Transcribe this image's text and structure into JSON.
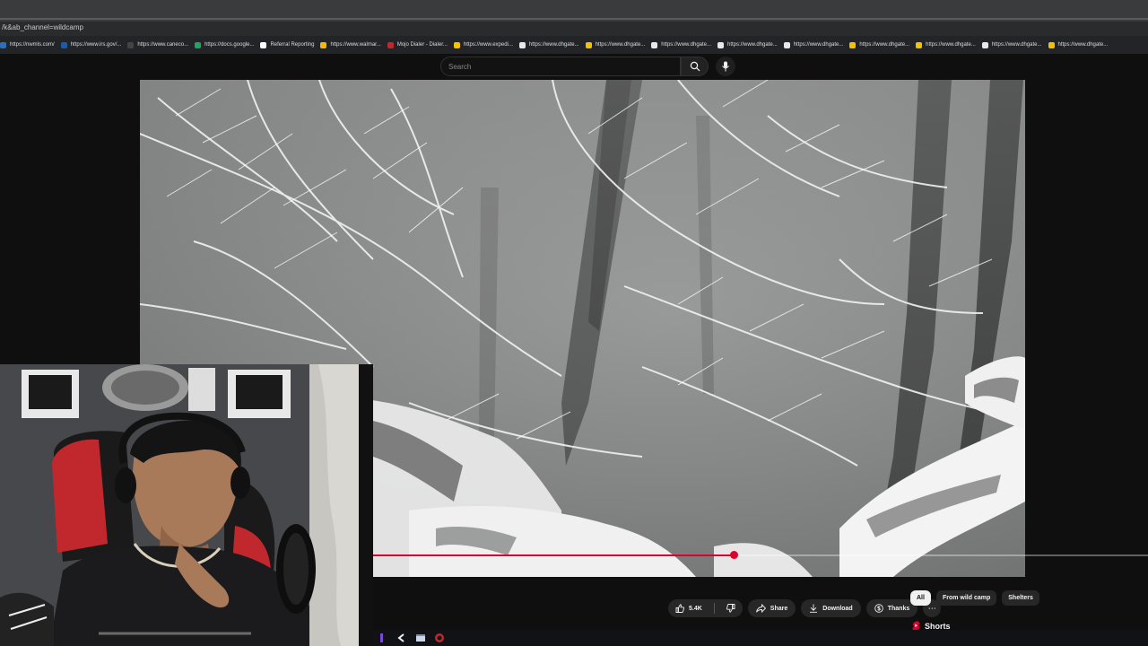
{
  "browser": {
    "url": "/k&ab_channel=wildcamp",
    "bookmarks": [
      {
        "label": "https://nwmls.com/",
        "color": "#2f6fb7"
      },
      {
        "label": "https://www.irs.gov/...",
        "color": "#1e5aa8"
      },
      {
        "label": "https://www.caneco...",
        "color": "#444444"
      },
      {
        "label": "https://docs.google...",
        "color": "#1fa463"
      },
      {
        "label": "Referral Reporting",
        "color": "#ffffff"
      },
      {
        "label": "https://www.walmar...",
        "color": "#f6b800"
      },
      {
        "label": "Mojo Dialer - Dialer...",
        "color": "#c0282d"
      },
      {
        "label": "https://www.expedi...",
        "color": "#f5c400"
      },
      {
        "label": "https://www.dhgate...",
        "color": "#e8e8e8"
      },
      {
        "label": "https://www.dhgate...",
        "color": "#f2c200"
      },
      {
        "label": "https://www.dhgate...",
        "color": "#e8e8e8"
      },
      {
        "label": "https://www.dhgate...",
        "color": "#e8e8e8"
      },
      {
        "label": "https://www.dhgate...",
        "color": "#e8e8e8"
      },
      {
        "label": "https://www.dhgate...",
        "color": "#f2c200"
      },
      {
        "label": "https://www.dhgate...",
        "color": "#f2c200"
      },
      {
        "label": "https://www.dhgate...",
        "color": "#e8e8e8"
      },
      {
        "label": "https://www.dhgate...",
        "color": "#f2c200"
      }
    ]
  },
  "youtube": {
    "search_placeholder": "Search",
    "progress_fraction": 0.466,
    "accent": "#e1002d",
    "actions": {
      "like_count": "5.4K",
      "share": "Share",
      "download": "Download",
      "thanks": "Thanks"
    },
    "chips": [
      "All",
      "From wild camp",
      "Shelters"
    ],
    "shorts_label": "Shorts"
  }
}
